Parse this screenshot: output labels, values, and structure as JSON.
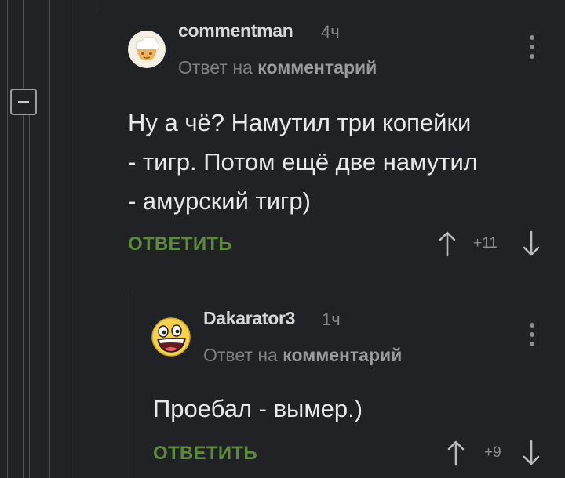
{
  "comments": [
    {
      "author": "commentman",
      "time": "4ч",
      "reply_prefix": "Ответ на",
      "reply_target": "комментарий",
      "text_lines": [
        "Ну а чё? Намутил три копейки",
        "- тигр. Потом ещё две намутил",
        "- амурский тигр)"
      ],
      "reply_label": "ОТВЕТИТЬ",
      "score": "+11"
    },
    {
      "author": "Dakarator3",
      "time": "1ч",
      "reply_prefix": "Ответ на",
      "reply_target": "комментарий",
      "text_lines": [
        "Проебал - вымер.)"
      ],
      "reply_label": "ОТВЕТИТЬ",
      "score": "+9"
    }
  ],
  "colors": {
    "background": "#212225",
    "accent_green": "#5c8a3c",
    "avatar_yellow": "#f6d24a"
  }
}
